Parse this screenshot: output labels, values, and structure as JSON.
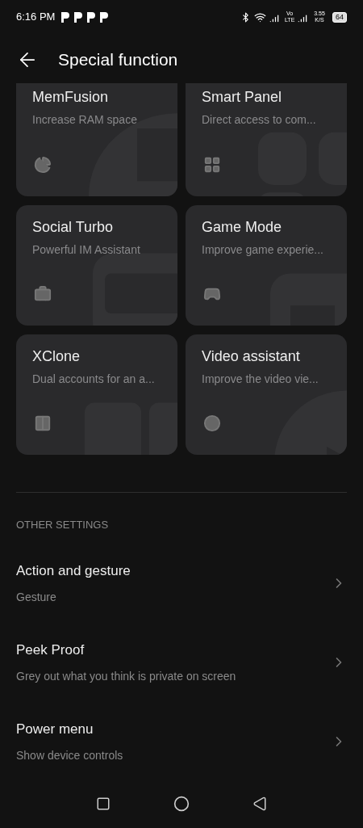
{
  "status_bar": {
    "time": "6:16 PM",
    "volte": "Vo LTE",
    "speed": "3.55 K/S",
    "battery": "64"
  },
  "header": {
    "title": "Special function"
  },
  "cards": [
    {
      "kind": "memory",
      "title": "MemFusion",
      "subtitle": "Increase RAM space"
    },
    {
      "kind": "panel",
      "title": "Smart Panel",
      "subtitle": "Direct access to com..."
    },
    {
      "kind": "social",
      "title": "Social Turbo",
      "subtitle": "Powerful IM Assistant"
    },
    {
      "kind": "game",
      "title": "Game Mode",
      "subtitle": "Improve game experie..."
    },
    {
      "kind": "clone",
      "title": "XClone",
      "subtitle": "Dual accounts for an a..."
    },
    {
      "kind": "video",
      "title": "Video assistant",
      "subtitle": "Improve the video vie..."
    }
  ],
  "section_label": "OTHER SETTINGS",
  "settings": [
    {
      "title": "Action and gesture",
      "subtitle": "Gesture"
    },
    {
      "title": "Peek Proof",
      "subtitle": "Grey out what you think is private on screen"
    },
    {
      "title": "Power menu",
      "subtitle": "Show device controls"
    }
  ]
}
